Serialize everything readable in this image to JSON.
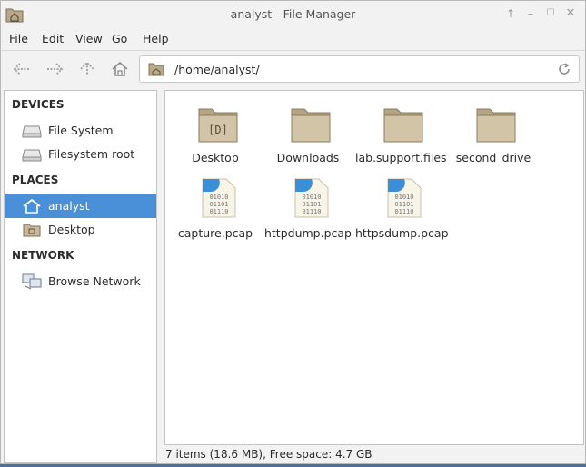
{
  "window": {
    "title": "analyst - File Manager",
    "controls": {
      "up": "↑",
      "minimize": "–",
      "maximize": "☐",
      "close": "✕"
    }
  },
  "menu": {
    "items": [
      {
        "label": "File"
      },
      {
        "label": "Edit"
      },
      {
        "label": "View"
      },
      {
        "label": "Go"
      },
      {
        "label": "Help"
      }
    ]
  },
  "toolbar": {
    "path": "/home/analyst/",
    "icons": [
      "back-icon",
      "forward-icon",
      "up-icon",
      "home-icon",
      "folder-icon",
      "reload-icon"
    ]
  },
  "sidebar": {
    "sections": [
      {
        "heading": "DEVICES",
        "items": [
          {
            "label": "File System",
            "icon": "drive-icon"
          },
          {
            "label": "Filesystem root",
            "icon": "drive-icon"
          }
        ]
      },
      {
        "heading": "PLACES",
        "items": [
          {
            "label": "analyst",
            "icon": "home-icon",
            "selected": true
          },
          {
            "label": "Desktop",
            "icon": "desktop-folder-icon"
          }
        ]
      },
      {
        "heading": "NETWORK",
        "items": [
          {
            "label": "Browse Network",
            "icon": "network-icon"
          }
        ]
      }
    ]
  },
  "files": [
    {
      "name": "Desktop",
      "type": "folder",
      "emblem": "D"
    },
    {
      "name": "Downloads",
      "type": "folder"
    },
    {
      "name": "lab.support.files",
      "type": "folder"
    },
    {
      "name": "second_drive",
      "type": "folder"
    },
    {
      "name": "capture.pcap",
      "type": "binary"
    },
    {
      "name": "httpdump.pcap",
      "type": "binary"
    },
    {
      "name": "httpsdump.pcap",
      "type": "binary"
    }
  ],
  "binary_icon_text": [
    "01010",
    "01101",
    "01110"
  ],
  "status": "7 items (18.6 MB), Free space: 4.7 GB",
  "colors": {
    "selection": "#4a90d9",
    "folder": "#c9b99a",
    "file_accent": "#3a8fd6"
  }
}
